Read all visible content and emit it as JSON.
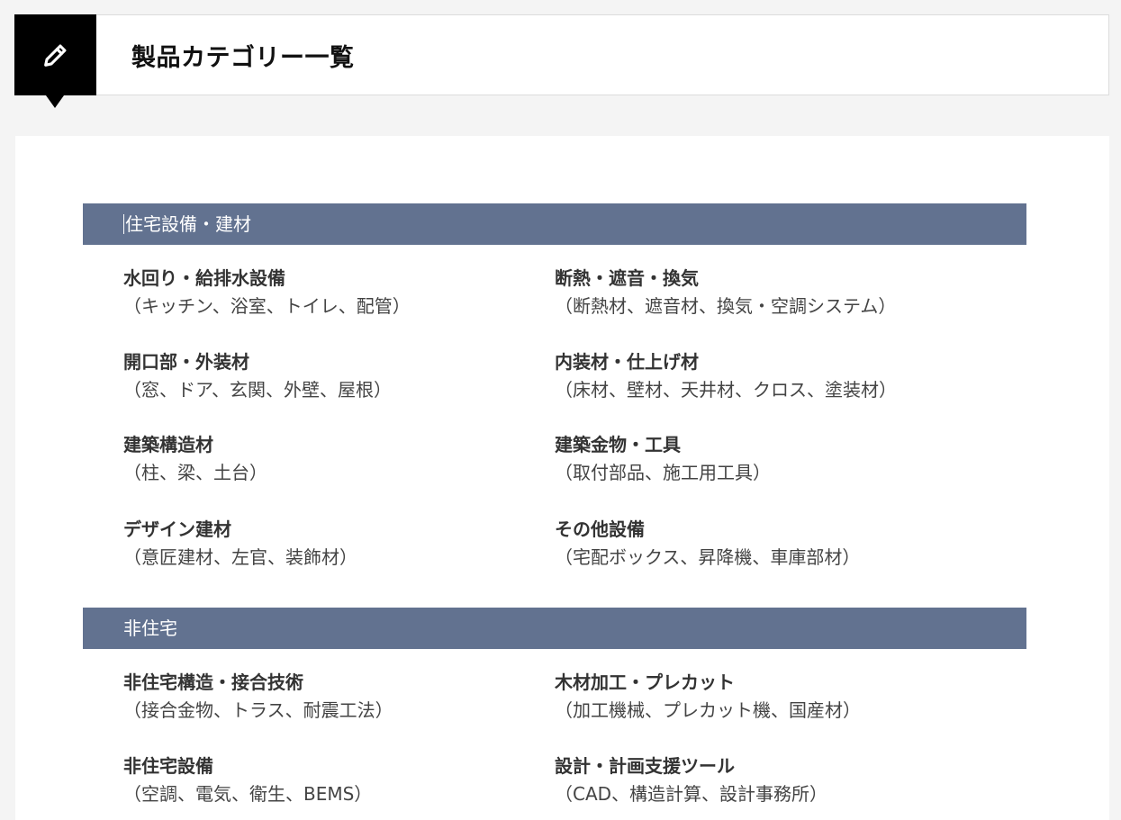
{
  "header": {
    "icon": "pencil-icon",
    "title": "製品カテゴリー一覧"
  },
  "sections": [
    {
      "label": "住宅設備・建材",
      "items": [
        {
          "title": "水回り・給排水設備",
          "desc": "（キッチン、浴室、トイレ、配管）"
        },
        {
          "title": "断熱・遮音・換気",
          "desc": "（断熱材、遮音材、換気・空調システム）"
        },
        {
          "title": "開口部・外装材",
          "desc": "（窓、ドア、玄関、外壁、屋根）"
        },
        {
          "title": "内装材・仕上げ材",
          "desc": "（床材、壁材、天井材、クロス、塗装材）"
        },
        {
          "title": "建築構造材",
          "desc": "（柱、梁、土台）"
        },
        {
          "title": "建築金物・工具",
          "desc": "（取付部品、施工用工具）"
        },
        {
          "title": "デザイン建材",
          "desc": "（意匠建材、左官、装飾材）"
        },
        {
          "title": "その他設備",
          "desc": "（宅配ボックス、昇降機、車庫部材）"
        }
      ]
    },
    {
      "label": "非住宅",
      "items": [
        {
          "title": "非住宅構造・接合技術",
          "desc": "（接合金物、トラス、耐震工法）"
        },
        {
          "title": "木材加工・プレカット",
          "desc": "（加工機械、プレカット機、国産材）"
        },
        {
          "title": "非住宅設備",
          "desc": "（空調、電気、衛生、BEMS）"
        },
        {
          "title": "設計・計画支援ツール",
          "desc": "（CAD、構造計算、設計事務所）"
        }
      ]
    }
  ]
}
